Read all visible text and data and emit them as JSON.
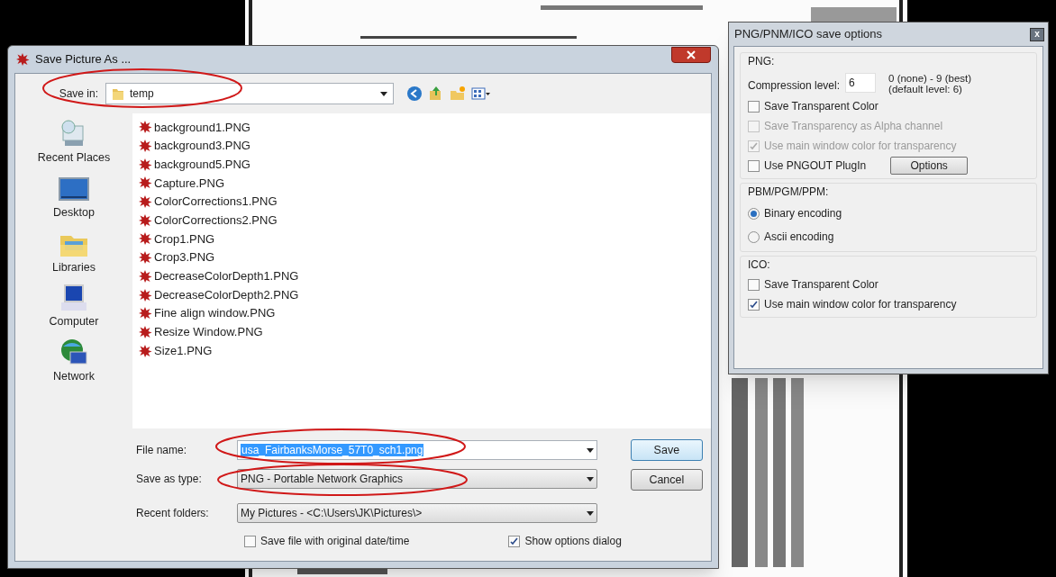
{
  "save_dialog": {
    "title": "Save Picture As ...",
    "save_in": {
      "label": "Save in:",
      "value": "temp"
    },
    "places": [
      {
        "label": "Recent Places",
        "kind": "recent"
      },
      {
        "label": "Desktop",
        "kind": "desktop"
      },
      {
        "label": "Libraries",
        "kind": "libraries"
      },
      {
        "label": "Computer",
        "kind": "computer"
      },
      {
        "label": "Network",
        "kind": "network"
      }
    ],
    "files": [
      "background1.PNG",
      "background3.PNG",
      "background5.PNG",
      "Capture.PNG",
      "ColorCorrections1.PNG",
      "ColorCorrections2.PNG",
      "Crop1.PNG",
      "Crop3.PNG",
      "DecreaseColorDepth1.PNG",
      "DecreaseColorDepth2.PNG",
      "Fine align window.PNG",
      "Resize Window.PNG",
      "Size1.PNG"
    ],
    "file_name": {
      "label": "File name:",
      "value": "usa_FairbanksMorse_57T0_sch1.png",
      "selected": true
    },
    "save_as_type": {
      "label": "Save as type:",
      "value": "PNG - Portable Network Graphics"
    },
    "recent_folders": {
      "label": "Recent folders:",
      "value": "My Pictures  -  <C:\\Users\\JK\\Pictures\\>"
    },
    "checkboxes": [
      {
        "label": "Save file with original date/time",
        "checked": false
      },
      {
        "label": "Show options dialog",
        "checked": true
      }
    ],
    "buttons": [
      "Save",
      "Cancel"
    ]
  },
  "options_dialog": {
    "title": "PNG/PNM/ICO save options",
    "close": "x",
    "png": {
      "heading": "PNG:",
      "compression_label": "Compression level:",
      "compression_value": "6",
      "range_note": "0 (none) - 9 (best)",
      "default_note": "(default level: 6)",
      "checkboxes": [
        {
          "label": "Save Transparent Color",
          "checked": false,
          "disabled": false
        },
        {
          "label": "Save Transparency as Alpha channel",
          "checked": false,
          "disabled": true
        },
        {
          "label": "Use main window color for transparency",
          "checked": true,
          "disabled": true
        },
        {
          "label": "Use PNGOUT PlugIn",
          "checked": false,
          "disabled": false
        }
      ],
      "options_button": "Options"
    },
    "pbm": {
      "heading": "PBM/PGM/PPM:",
      "radios": [
        {
          "label": "Binary encoding",
          "selected": true
        },
        {
          "label": "Ascii encoding",
          "selected": false
        }
      ]
    },
    "ico": {
      "heading": "ICO:",
      "checkboxes": [
        {
          "label": "Save Transparent Color",
          "checked": false,
          "disabled": false
        },
        {
          "label": "Use main window color for transparency",
          "checked": true,
          "disabled": false
        }
      ]
    }
  }
}
